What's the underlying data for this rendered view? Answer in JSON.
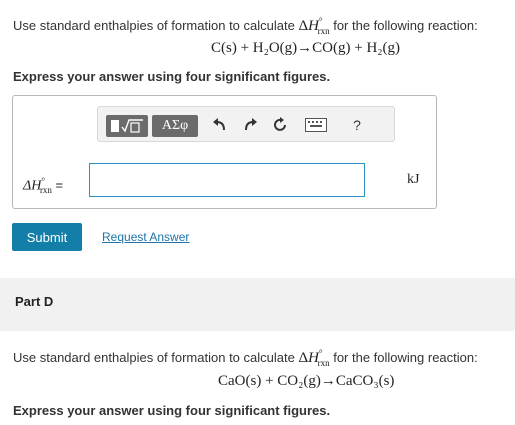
{
  "part_c": {
    "prompt_before": "Use standard enthalpies of formation to calculate",
    "prompt_after": "for the following reaction:",
    "equation": "C(s) + H₂O(g)→CO(g) + H₂(g)",
    "instruction": "Express your answer using four significant figures."
  },
  "answer": {
    "label_symbol": "ΔH",
    "label_sup": "°",
    "label_sub": "rxn",
    "label_equals": "=",
    "value": "",
    "unit": "kJ"
  },
  "toolbar": {
    "greek_label": "ΑΣφ",
    "help_label": "?",
    "icons": [
      "templates-icon",
      "greek-icon",
      "undo-icon",
      "redo-icon",
      "reset-icon",
      "keyboard-icon",
      "help-icon"
    ]
  },
  "actions": {
    "submit_label": "Submit",
    "request_label": "Request Answer"
  },
  "part_d": {
    "title": "Part D",
    "prompt_before": "Use standard enthalpies of formation to calculate",
    "prompt_after": "for the following reaction:",
    "equation": "CaO(s) + CO₂(g)→CaCO₃(s)",
    "instruction": "Express your answer using four significant figures."
  },
  "colors": {
    "submit_bg": "#137fa8",
    "link": "#1e74a6",
    "input_border": "#2e8fc3",
    "part_bg": "#f1f1f1"
  }
}
